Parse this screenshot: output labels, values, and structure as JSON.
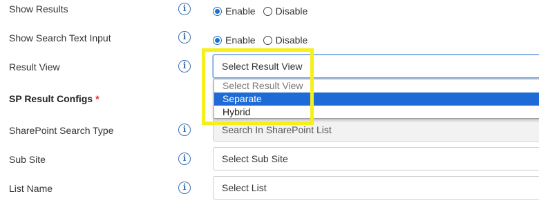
{
  "form": {
    "show_results": {
      "label": "Show Results",
      "options": [
        "Enable",
        "Disable"
      ],
      "selected": "Enable"
    },
    "show_search_text_input": {
      "label": "Show Search Text Input",
      "options": [
        "Enable",
        "Disable"
      ],
      "selected": "Enable"
    },
    "result_view": {
      "label": "Result View",
      "value": "Select Result View",
      "dropdown_options": [
        "Select Result View",
        "Separate",
        "Hybrid"
      ],
      "highlighted_option": "Separate"
    },
    "sp_result_configs": {
      "label": "SP Result Configs",
      "required_mark": "*"
    },
    "sharepoint_search_type": {
      "label": "SharePoint Search Type",
      "value": "Search In SharePoint List"
    },
    "sub_site": {
      "label": "Sub Site",
      "value": "Select Sub Site"
    },
    "list_name": {
      "label": "List Name",
      "value": "Select List"
    }
  },
  "info_icon_glyph": "i",
  "colors": {
    "accent": "#1e6ad6",
    "highlight_box": "#f5ef1a",
    "required": "#d62c2c"
  }
}
